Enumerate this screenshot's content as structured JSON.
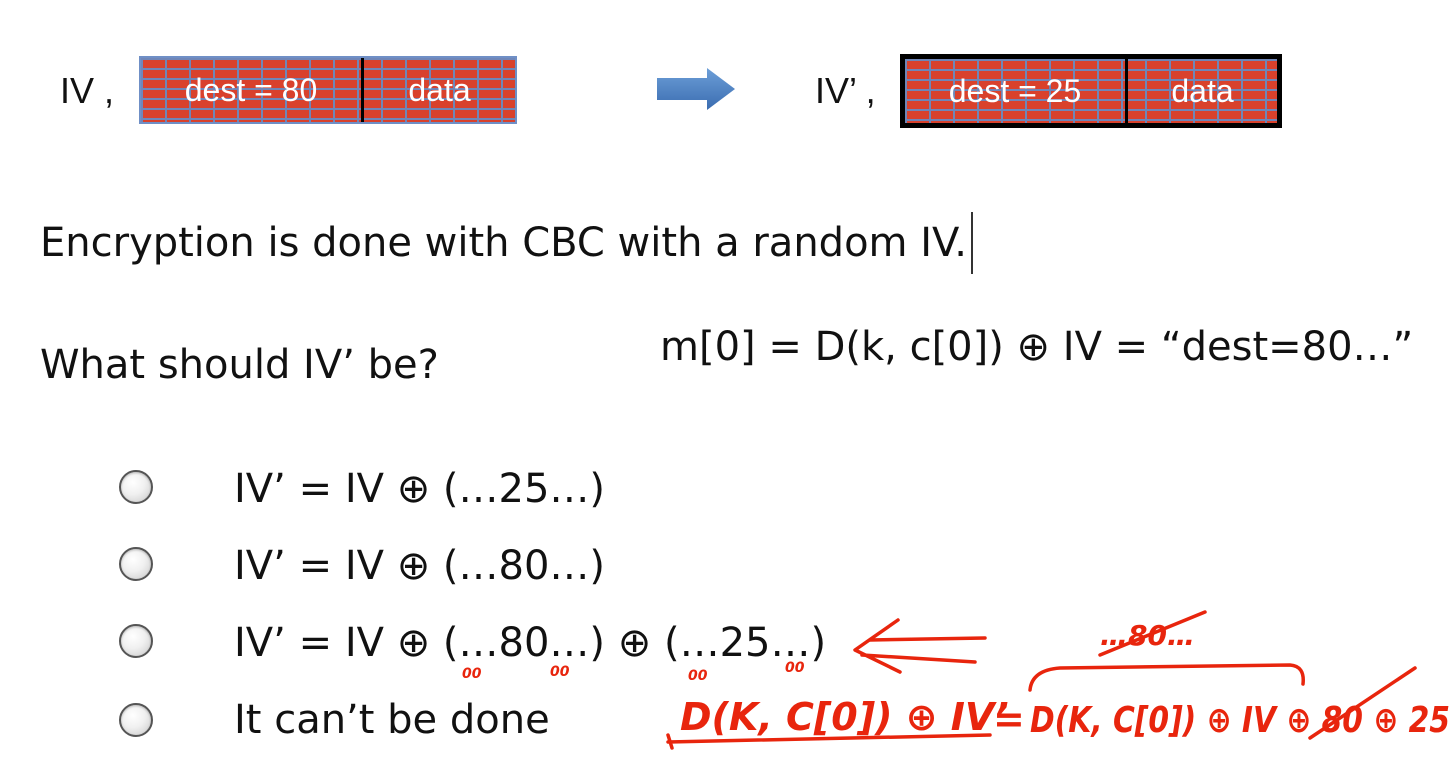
{
  "diagram": {
    "iv_label": "IV ,",
    "iv_prime_label": "IV’ ,",
    "left_block": {
      "dest": "dest = 80",
      "data": "data"
    },
    "right_block": {
      "dest": "dest = 25",
      "data": "data"
    },
    "arrow_icon": "right-arrow-icon"
  },
  "text": {
    "line1": "Encryption is done with CBC with a random IV.",
    "question": "What should IV’ be?",
    "equation": "m[0] = D(k, c[0]) ⊕ IV  = “dest=80…”"
  },
  "options": [
    {
      "label": "IV’ = IV ⊕ (…25…)"
    },
    {
      "label": "IV’ = IV ⊕ (…80…)"
    },
    {
      "label": "IV’ = IV ⊕ (…80…) ⊕ (…25…)"
    },
    {
      "label": "It can’t be done"
    }
  ],
  "annotations": {
    "color": "#e8250d",
    "above_brace": "…80…",
    "lhs": "D(K, C[0]) ⊕ IV’",
    "eq_sign": "=",
    "rhs": "D(K, C[0]) ⊕ IV ⊕ 80 ⊕ 25",
    "small_marks": [
      "00",
      "00",
      "00",
      "00"
    ],
    "arrow_icon": "left-arrow-icon"
  },
  "colors": {
    "brick_red": "#d9412c",
    "brick_mortar": "#6f86b8",
    "arrow_blue": "#4a7fc2"
  }
}
